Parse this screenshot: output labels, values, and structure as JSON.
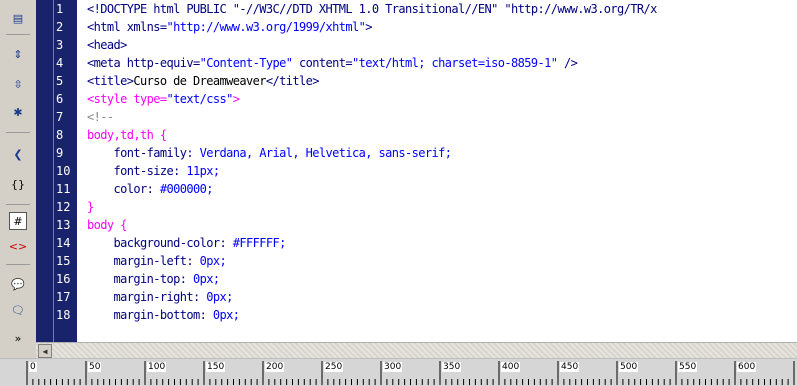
{
  "toolbar": {
    "icons": [
      "open-documents-icon",
      "collapse-full-tag-icon",
      "collapse-selection-icon",
      "expand-all-icon",
      "select-parent-tag-icon",
      "balance-braces-icon",
      "line-numbers-icon",
      "highlight-invalid-code-icon",
      "apply-comment-icon",
      "remove-comment-icon",
      "more-icon"
    ]
  },
  "line_numbers": [
    "1",
    "2",
    "3",
    "4",
    "5",
    "6",
    "7",
    "8",
    "9",
    "10",
    "11",
    "12",
    "13",
    "14",
    "15",
    "16",
    "17",
    "18"
  ],
  "code_lines": [
    [
      {
        "t": "<!DOCTYPE html PUBLIC \"-//W3C//DTD XHTML 1.0 Transitional//EN\" \"http://www.w3.org/TR/x",
        "c": "c-tag"
      }
    ],
    [
      {
        "t": "<html xmlns=",
        "c": "c-tag"
      },
      {
        "t": "\"http://www.w3.org/1999/xhtml\"",
        "c": "c-str"
      },
      {
        "t": ">",
        "c": "c-tag"
      }
    ],
    [
      {
        "t": "<head>",
        "c": "c-tag"
      }
    ],
    [
      {
        "t": "<meta http-equiv=",
        "c": "c-tag"
      },
      {
        "t": "\"Content-Type\"",
        "c": "c-str"
      },
      {
        "t": " content=",
        "c": "c-tag"
      },
      {
        "t": "\"text/html; charset=iso-8859-1\"",
        "c": "c-str"
      },
      {
        "t": " />",
        "c": "c-tag"
      }
    ],
    [
      {
        "t": "<title>",
        "c": "c-tag"
      },
      {
        "t": "Curso de Dreamweaver",
        "c": "c-text"
      },
      {
        "t": "</title>",
        "c": "c-tag"
      }
    ],
    [
      {
        "t": "<style type=",
        "c": "c-sel"
      },
      {
        "t": "\"text/css\"",
        "c": "c-str"
      },
      {
        "t": ">",
        "c": "c-sel"
      }
    ],
    [
      {
        "t": "<!--",
        "c": "c-cmt"
      }
    ],
    [
      {
        "t": "body,td,th {",
        "c": "c-sel"
      }
    ],
    [
      {
        "t": "    font-family: ",
        "c": "c-prop"
      },
      {
        "t": "Verdana, Arial, Helvetica, sans-serif;",
        "c": "c-val"
      }
    ],
    [
      {
        "t": "    font-size: ",
        "c": "c-prop"
      },
      {
        "t": "11px;",
        "c": "c-val"
      }
    ],
    [
      {
        "t": "    color: ",
        "c": "c-prop"
      },
      {
        "t": "#000000;",
        "c": "c-val"
      }
    ],
    [
      {
        "t": "}",
        "c": "c-brace"
      }
    ],
    [
      {
        "t": "body {",
        "c": "c-sel"
      }
    ],
    [
      {
        "t": "    background-color: ",
        "c": "c-prop"
      },
      {
        "t": "#FFFFFF;",
        "c": "c-val"
      }
    ],
    [
      {
        "t": "    margin-left: ",
        "c": "c-prop"
      },
      {
        "t": "0px;",
        "c": "c-val"
      }
    ],
    [
      {
        "t": "    margin-top: ",
        "c": "c-prop"
      },
      {
        "t": "0px;",
        "c": "c-val"
      }
    ],
    [
      {
        "t": "    margin-right: ",
        "c": "c-prop"
      },
      {
        "t": "0px;",
        "c": "c-val"
      }
    ],
    [
      {
        "t": "    margin-bottom: ",
        "c": "c-prop"
      },
      {
        "t": "0px;",
        "c": "c-val"
      }
    ]
  ],
  "ruler": {
    "labels": [
      "0",
      "50",
      "100",
      "150",
      "200",
      "250",
      "300",
      "350",
      "400",
      "450",
      "500",
      "550",
      "600"
    ]
  }
}
